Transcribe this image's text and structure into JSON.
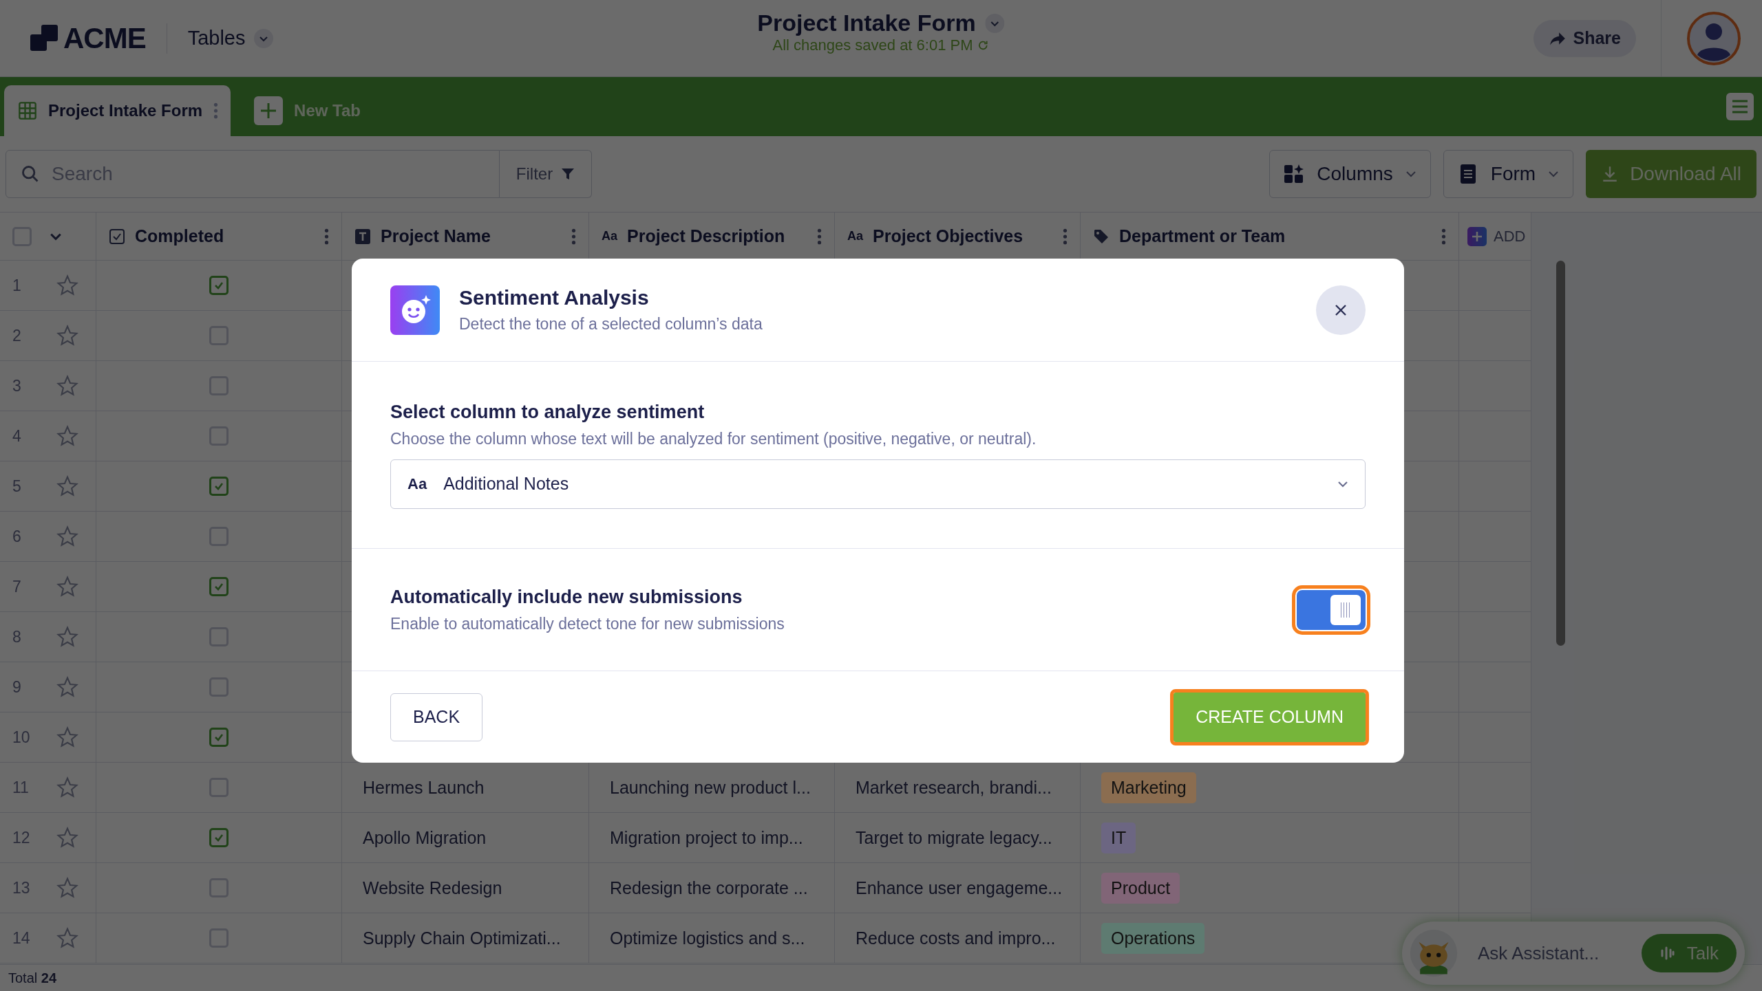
{
  "header": {
    "logo": "ACME",
    "section": "Tables",
    "title": "Project Intake Form",
    "save_status": "All changes saved at 6:01 PM",
    "share": "Share"
  },
  "tabs": [
    {
      "label": "Project Intake Form",
      "selected": true
    },
    {
      "label": "New Tab",
      "selected": false
    }
  ],
  "toolbar": {
    "search_placeholder": "Search",
    "filter": "Filter",
    "columns": "Columns",
    "form": "Form",
    "download": "Download All"
  },
  "table": {
    "select_all_checked": false,
    "columns": [
      {
        "label": "Completed",
        "kind": "checkbox"
      },
      {
        "label": "Project Name",
        "kind": "text"
      },
      {
        "label": "Project Description",
        "kind": "longtext",
        "glyph": "Aa"
      },
      {
        "label": "Project Objectives",
        "kind": "longtext",
        "glyph": "Aa"
      },
      {
        "label": "Department or Team",
        "kind": "tag"
      }
    ],
    "add_column": "ADD",
    "rows": [
      {
        "number": "1",
        "checked": true
      },
      {
        "number": "2",
        "checked": false
      },
      {
        "number": "3",
        "checked": false
      },
      {
        "number": "4",
        "checked": false
      },
      {
        "number": "5",
        "checked": true
      },
      {
        "number": "6",
        "checked": false
      },
      {
        "number": "7",
        "checked": true
      },
      {
        "number": "8",
        "checked": false
      },
      {
        "number": "9",
        "checked": false
      },
      {
        "number": "10",
        "checked": true
      },
      {
        "number": "11",
        "checked": false,
        "name": "Hermes Launch",
        "description": "Launching new product l...",
        "objectives": "Market research, brandi...",
        "department": "Marketing",
        "color": "#8b6d50"
      },
      {
        "number": "12",
        "checked": true,
        "name": "Apollo Migration",
        "description": "Migration project to imp...",
        "objectives": "Target to migrate legacy...",
        "department": "IT",
        "color": "#6c6682"
      },
      {
        "number": "13",
        "checked": false,
        "name": "Website Redesign",
        "description": "Redesign the corporate ...",
        "objectives": "Enhance user engageme...",
        "department": "Product",
        "color": "#816577"
      },
      {
        "number": "14",
        "checked": false,
        "name": "Supply Chain Optimizati...",
        "description": "Optimize logistics and s...",
        "objectives": "Reduce costs and impro...",
        "department": "Operations",
        "color": "#5e7b71"
      }
    ],
    "total_label": "Total",
    "total_value": "24"
  },
  "assistant": {
    "placeholder": "Ask Assistant...",
    "talk": "Talk"
  },
  "modal": {
    "title": "Sentiment Analysis",
    "subtitle": "Detect the tone of a selected column’s data",
    "select_section": {
      "title": "Select column to analyze sentiment",
      "description": "Choose the column whose text will be analyzed for sentiment (positive, negative, or neutral).",
      "glyph": "Aa",
      "value": "Additional Notes"
    },
    "auto_section": {
      "title": "Automatically include new submissions",
      "description": "Enable to automatically detect tone for new submissions",
      "on": true,
      "highlighted": true
    },
    "back": "BACK",
    "create": {
      "label": "CREATE COLUMN",
      "highlighted": true
    }
  }
}
